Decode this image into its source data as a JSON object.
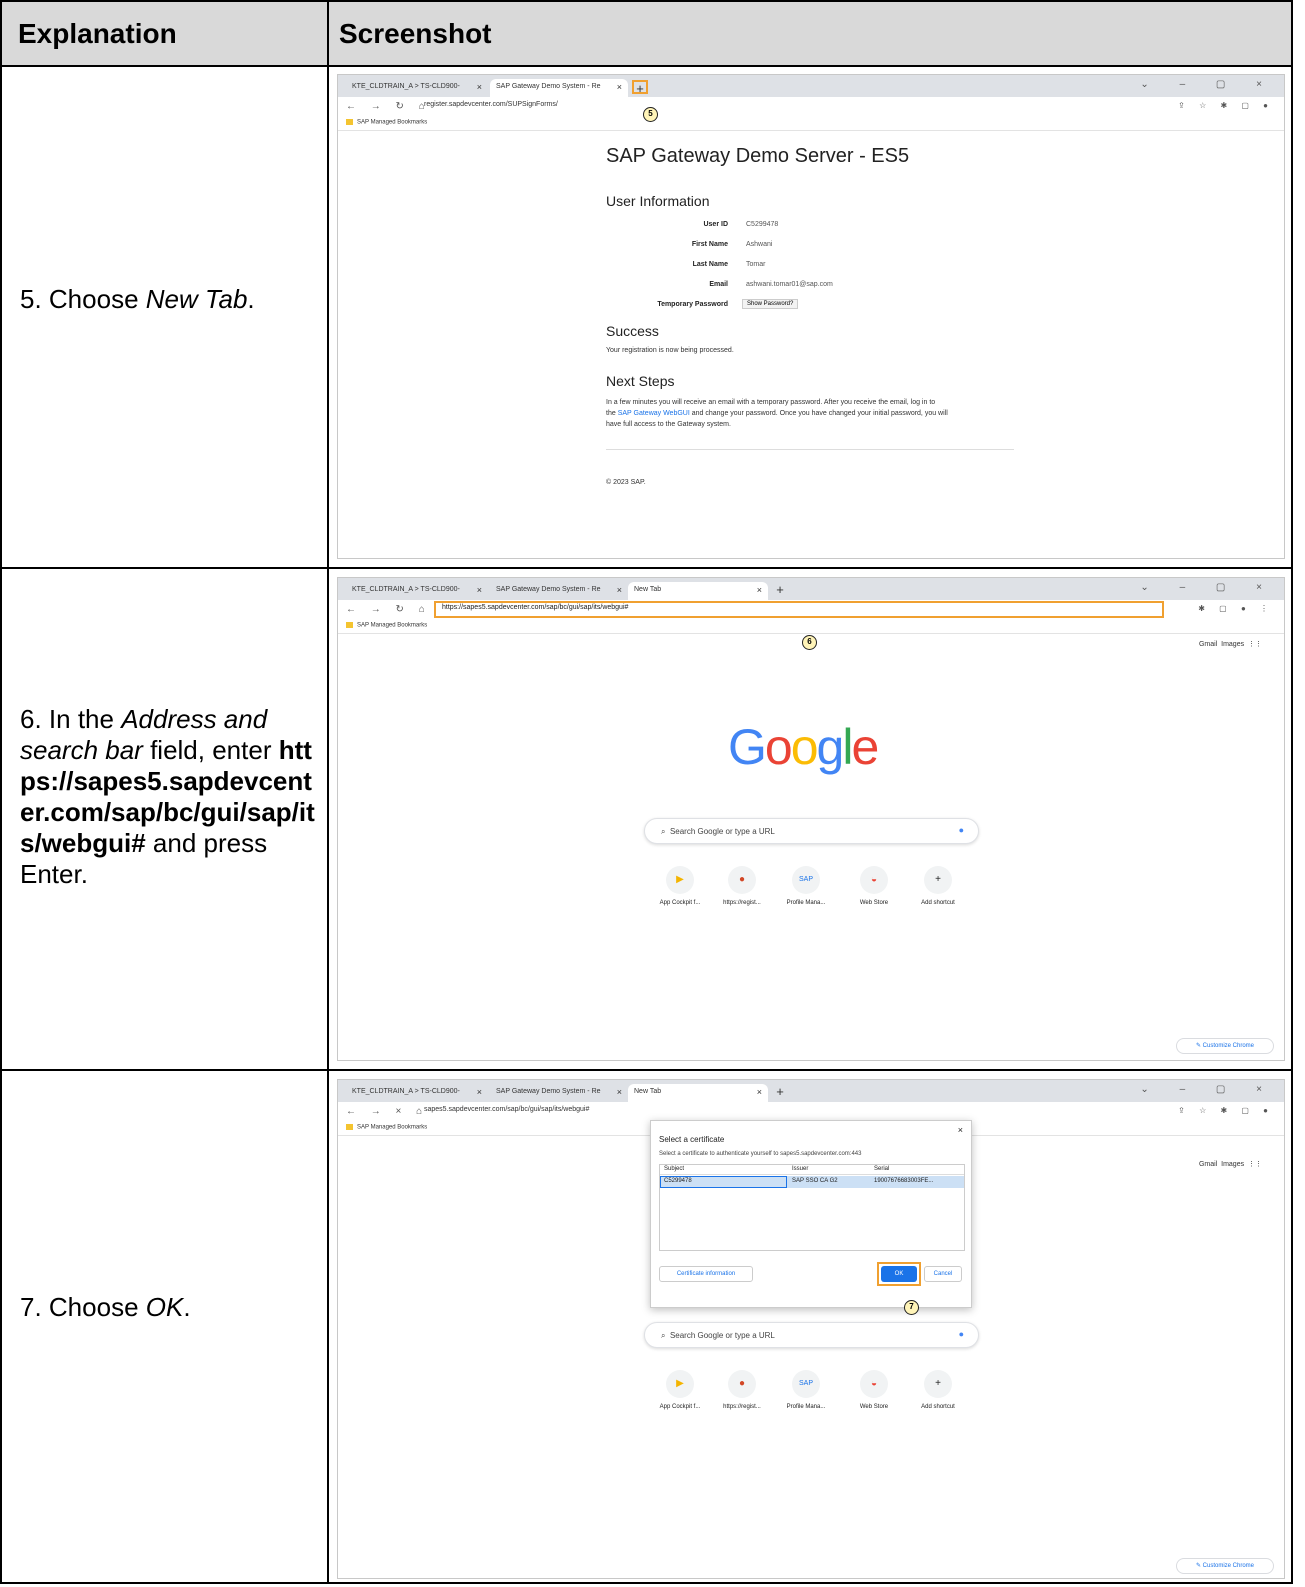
{
  "header": {
    "col1": "Explanation",
    "col2": "Screenshot"
  },
  "browser": {
    "tab1": "KTE_CLDTRAIN_A > TS-CLD900-",
    "tab2": "SAP Gateway Demo System - Re",
    "tab3": "New Tab",
    "bookmarks": "SAP Managed Bookmarks",
    "url_step5": "register.sapdevcenter.com/SUPSignForms/",
    "url_step6": "https://sapes5.sapdevcenter.com/sap/bc/gui/sap/its/webgui#",
    "url_step7": "sapes5.sapdevcenter.com/sap/bc/gui/sap/its/webgui#"
  },
  "step5": {
    "explanation_prefix": "5. Choose ",
    "explanation_em": "New Tab",
    "explanation_suffix": ".",
    "callout": "5",
    "page_title": "SAP Gateway Demo Server - ES5",
    "user_info_heading": "User Information",
    "fields": [
      {
        "label": "User ID",
        "value": "C5299478"
      },
      {
        "label": "First Name",
        "value": "Ashwani"
      },
      {
        "label": "Last Name",
        "value": "Tomar"
      },
      {
        "label": "Email",
        "value": "ashwani.tomar01@sap.com"
      },
      {
        "label": "Temporary Password",
        "value": "Show Password?"
      }
    ],
    "success_heading": "Success",
    "success_text": "Your registration is now being processed.",
    "next_heading": "Next Steps",
    "next_text_1": "In a few minutes you will receive an email with a temporary password. After you receive the email, log in to",
    "next_text_2a": "the ",
    "next_text_link": "SAP Gateway WebGUI",
    "next_text_2b": " and change your password. Once you have changed your initial password, you will",
    "next_text_3": "have full access to the Gateway system.",
    "footer": "© 2023 SAP."
  },
  "step6": {
    "expl_1": "6. In the ",
    "expl_em": "Address and search bar",
    "expl_2": " field, enter ",
    "expl_bold": "https://sapes5.sapdevcenter.com/sap/bc/gui/sap/its/webgui#",
    "expl_3": " and press Enter.",
    "callout": "6"
  },
  "google": {
    "gmail": "Gmail",
    "images": "Images",
    "search_placeholder": "Search Google or type a URL",
    "shortcuts": [
      "App Cockpit f...",
      "https://regist...",
      "Profile Mana...",
      "Web Store",
      "Add shortcut"
    ],
    "customize": "Customize Chrome"
  },
  "step7": {
    "expl_prefix": "7. Choose ",
    "expl_em": "OK",
    "expl_suffix": ".",
    "callout": "7",
    "dialog_title": "Select a certificate",
    "dialog_sub": "Select a certificate to authenticate yourself to sapes5.sapdevcenter.com:443",
    "col_subject": "Subject",
    "col_issuer": "Issuer",
    "col_serial": "Serial",
    "row_subject": "C5299478",
    "row_issuer": "SAP SSO CA G2",
    "row_serial": "19007676683003FE...",
    "cert_info_btn": "Certificate information",
    "ok_btn": "OK",
    "cancel_btn": "Cancel"
  }
}
